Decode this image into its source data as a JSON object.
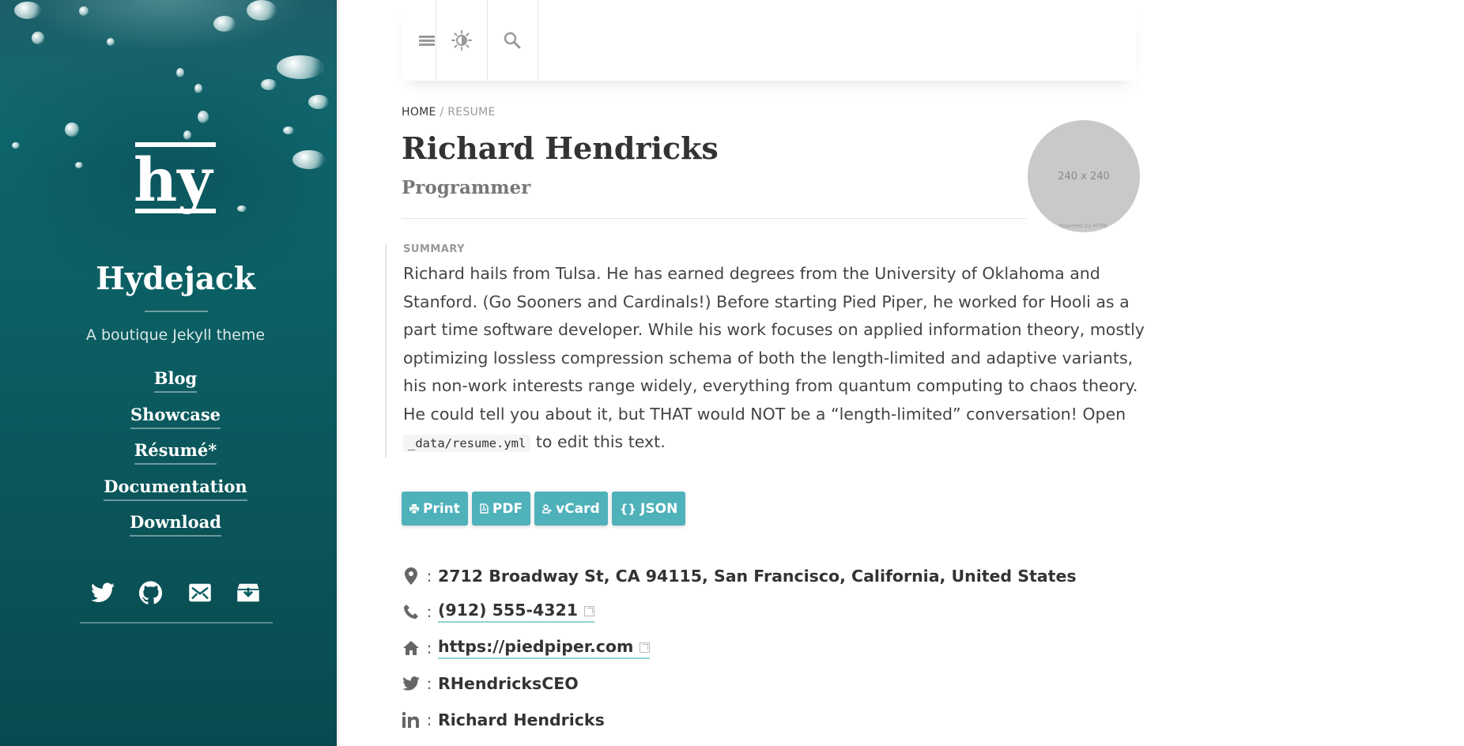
{
  "sidebar": {
    "logo_text": "hy",
    "title": "Hydejack",
    "tagline": "A boutique Jekyll theme",
    "nav": [
      {
        "label": "Blog"
      },
      {
        "label": "Showcase"
      },
      {
        "label": "Résumé*"
      },
      {
        "label": "Documentation"
      },
      {
        "label": "Download"
      }
    ],
    "social": [
      "twitter-icon",
      "github-icon",
      "email-icon",
      "download-box-icon"
    ]
  },
  "topbar": {
    "icons": [
      "menu-icon",
      "theme-toggle-icon",
      "search-icon"
    ]
  },
  "breadcrumb": {
    "home": "HOME",
    "separator": "/",
    "current": "RESUME"
  },
  "resume": {
    "name": "Richard Hendricks",
    "label": "Programmer",
    "avatar_placeholder": "240 x 240",
    "avatar_powered": "Powered by HTML",
    "summary_title": "SUMMARY",
    "summary_text_before": "Richard hails from Tulsa. He has earned degrees from the University of Oklahoma and Stanford. (Go Sooners and Cardinals!) Before starting Pied Piper, he worked for Hooli as a part time software developer. While his work focuses on applied information theory, mostly optimizing lossless compression schema of both the length-limited and adaptive variants, his non-work interests range widely, everything from quantum computing to chaos theory. He could tell you about it, but THAT would NOT be a “length-limited” conversation! Open",
    "summary_code": "_data/resume.yml",
    "summary_text_after": "to edit this text."
  },
  "buttons": [
    {
      "label": "Print",
      "icon": "print-icon"
    },
    {
      "label": "PDF",
      "icon": "pdf-icon"
    },
    {
      "label": "vCard",
      "icon": "vcard-icon"
    },
    {
      "label": "JSON",
      "icon": "json-icon"
    }
  ],
  "contacts": {
    "address": "2712 Broadway St, CA 94115, San Francisco, California, United States",
    "phone": "(912) 555-4321",
    "website": "https://piedpiper.com",
    "twitter": "RHendricksCEO",
    "linkedin": "Richard Hendricks"
  },
  "colors": {
    "accent": "#4fb1ba",
    "sidebar_bg": "#0b5f63",
    "text": "#333333"
  }
}
